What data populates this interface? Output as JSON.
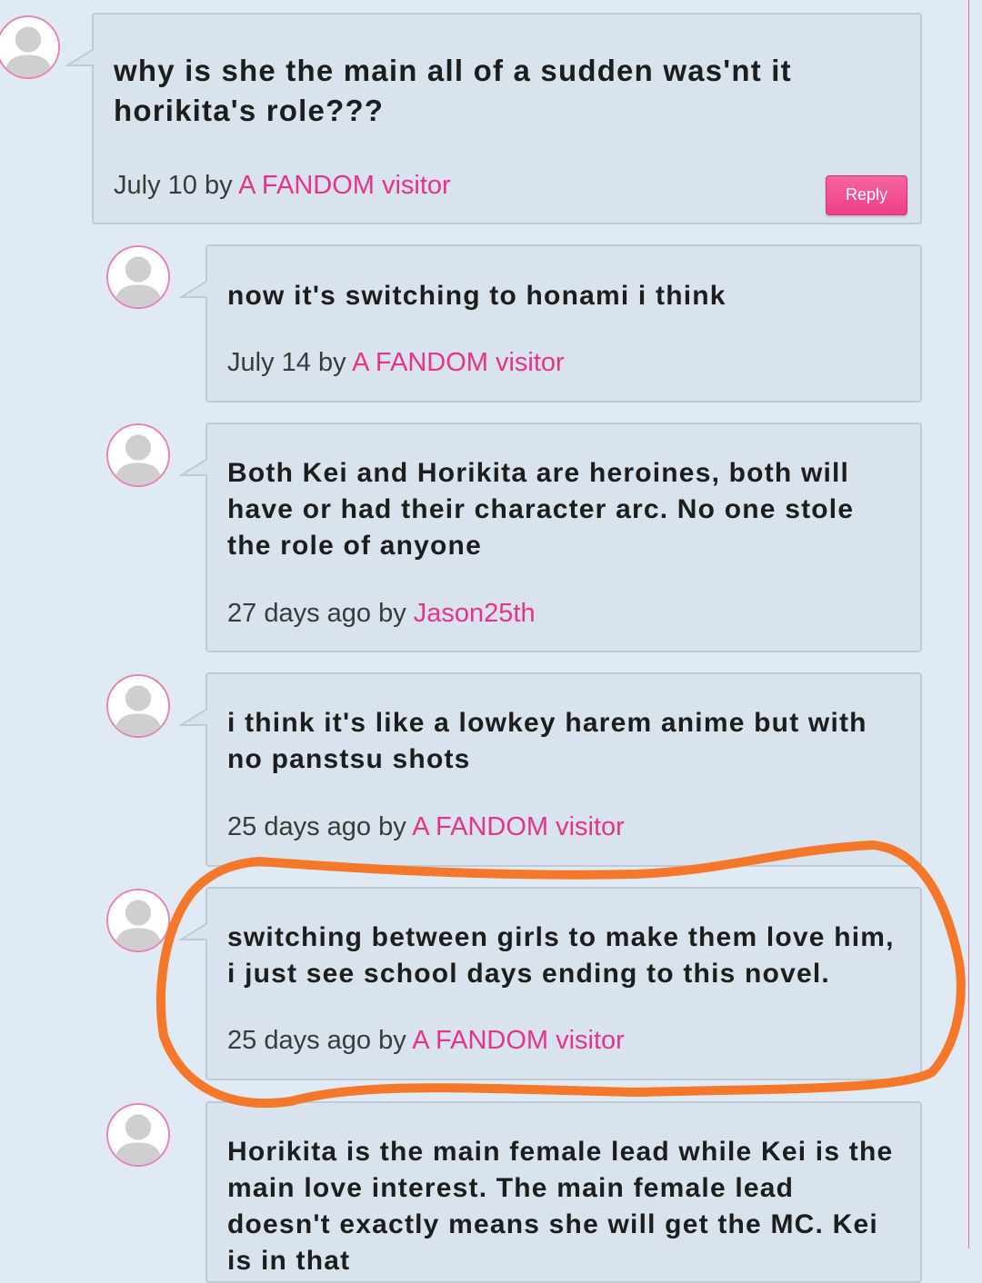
{
  "comments": [
    {
      "text": "why is she the main all of a sudden was'nt it horikita's role???",
      "date": "July 10",
      "by": "by",
      "author": "A FANDOM visitor",
      "reply_label": "Reply"
    },
    {
      "text": "now it's switching to honami  i think",
      "date": "July 14",
      "by": "by",
      "author": "A FANDOM visitor"
    },
    {
      "text": "Both Kei and Horikita are heroines, both will have or had their character arc. No one stole the role of anyone",
      "date": "27 days ago",
      "by": "by",
      "author": "Jason25th"
    },
    {
      "text": "i think it's like a lowkey harem anime but with no panstsu shots",
      "date": "25 days ago",
      "by": "by",
      "author": "A FANDOM visitor"
    },
    {
      "text": "switching between girls to make them love him, i just see school days ending to this novel.",
      "date": "25 days ago",
      "by": "by",
      "author": "A FANDOM visitor"
    },
    {
      "text": "Horikita is the main female lead while Kei is the main love interest. The main female lead doesn't exactly means she will get the MC. Kei is in that"
    }
  ],
  "colors": {
    "author_link": "#e8338a",
    "reply_button": "#ef4a8c",
    "highlight_circle": "#f5772a"
  },
  "icons": [
    "avatar-placeholder-icon"
  ]
}
